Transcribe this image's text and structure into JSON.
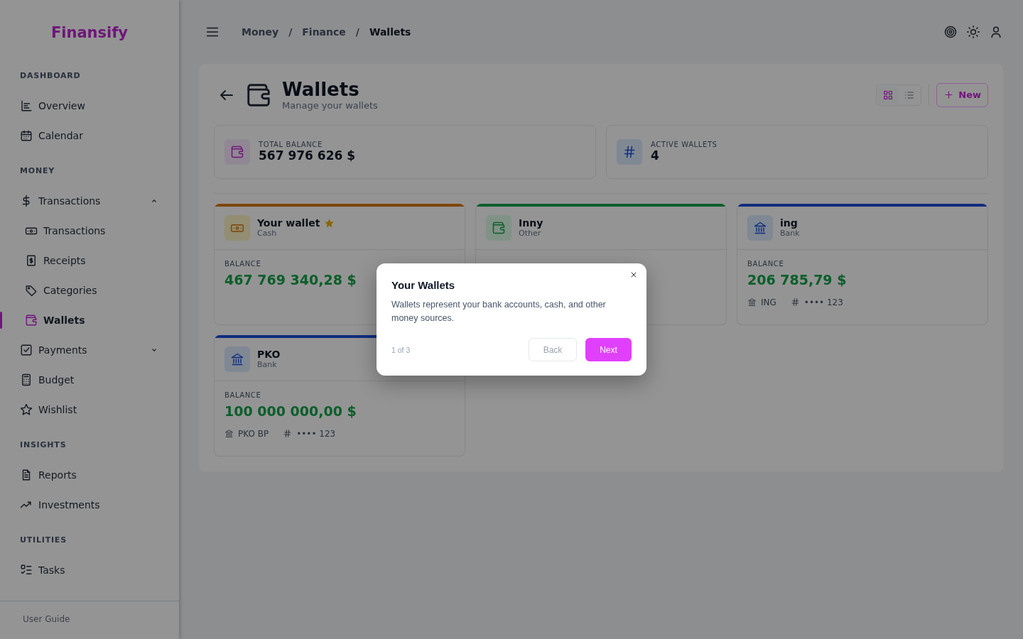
{
  "logo": "Finansify",
  "sidebar": {
    "sections": [
      {
        "title": "DASHBOARD",
        "items": [
          {
            "label": "Overview",
            "selected": false
          },
          {
            "label": "Calendar",
            "selected": false
          }
        ]
      },
      {
        "title": "MONEY",
        "items": [
          {
            "label": "Transactions",
            "selected": false,
            "expanded": true,
            "children": [
              {
                "label": "Transactions",
                "selected": false
              },
              {
                "label": "Receipts",
                "selected": false
              },
              {
                "label": "Categories",
                "selected": false
              },
              {
                "label": "Wallets",
                "selected": true
              }
            ]
          },
          {
            "label": "Payments",
            "selected": false,
            "expanded": false
          },
          {
            "label": "Budget",
            "selected": false
          },
          {
            "label": "Wishlist",
            "selected": false
          }
        ]
      },
      {
        "title": "INSIGHTS",
        "items": [
          {
            "label": "Reports",
            "selected": false
          },
          {
            "label": "Investments",
            "selected": false
          }
        ]
      },
      {
        "title": "UTILITIES",
        "items": [
          {
            "label": "Tasks",
            "selected": false
          }
        ]
      }
    ],
    "footer": "User Guide"
  },
  "breadcrumbs": [
    {
      "label": "Money",
      "current": false
    },
    {
      "label": "Finance",
      "current": false
    },
    {
      "label": "Wallets",
      "current": true
    }
  ],
  "breadcrumb_separators": [
    "/",
    "/"
  ],
  "page": {
    "title": "Wallets",
    "subtitle": "Manage your wallets",
    "view_toggle": [
      {
        "selected": true
      },
      {
        "selected": false
      }
    ],
    "new_button": "New",
    "stats": [
      {
        "label": "TOTAL BALANCE",
        "value": "567 976 626 $"
      },
      {
        "label": "ACTIVE WALLETS",
        "value": "4"
      }
    ],
    "wallets": [
      {
        "kind": "cash",
        "name": "Your wallet",
        "type": "Cash",
        "favorite": true,
        "balance_label": "BALANCE",
        "balance": "467 769 340,28 $"
      },
      {
        "kind": "other",
        "name": "Inny",
        "type": "Other",
        "favorite": false
      },
      {
        "kind": "bank",
        "name": "ing",
        "type": "Bank",
        "favorite": false,
        "balance_label": "BALANCE",
        "balance": "206 785,79 $",
        "bank": "ING",
        "account": "•••• 123"
      },
      {
        "kind": "bank",
        "name": "PKO",
        "type": "Bank",
        "favorite": false,
        "balance_label": "BALANCE",
        "balance": "100 000 000,00 $",
        "bank": "PKO BP",
        "account": "•••• 123"
      }
    ]
  },
  "tour": {
    "title": "Your Wallets",
    "text": "Wallets represent your bank accounts, cash, and other money sources.",
    "step": "1 of 3",
    "back": {
      "label": "Back",
      "disabled": true
    },
    "next": "Next"
  }
}
